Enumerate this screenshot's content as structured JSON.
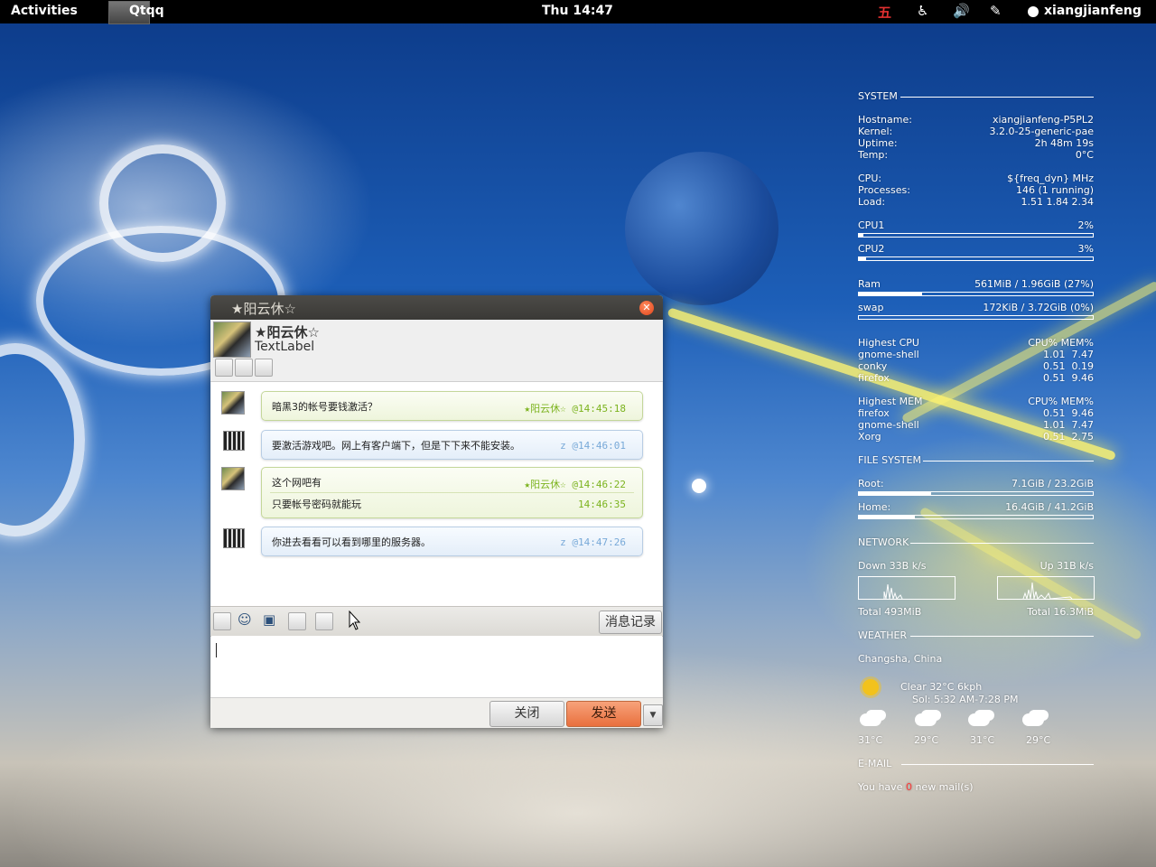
{
  "topbar": {
    "activities": "Activities",
    "app_name": "Qtqq",
    "clock": "Thu 14:47",
    "ime_indicator": "五",
    "icons": [
      "accessibility-icon",
      "volume-icon",
      "network-icon"
    ],
    "user": "xiangjianfeng"
  },
  "conky": {
    "system": {
      "title": "SYSTEM",
      "rows": [
        {
          "label": "Hostname:",
          "value": "xiangjianfeng-P5PL2"
        },
        {
          "label": "Kernel:",
          "value": "3.2.0-25-generic-pae"
        },
        {
          "label": "Uptime:",
          "value": "2h 48m 19s"
        },
        {
          "label": "Temp:",
          "value": "0°C"
        }
      ],
      "rows2": [
        {
          "label": "CPU:",
          "value": "${freq_dyn} MHz"
        },
        {
          "label": "Processes:",
          "value": "146 (1 running)"
        },
        {
          "label": "Load:",
          "value": "1.51 1.84 2.34"
        }
      ],
      "cpu1": {
        "label": "CPU1",
        "value": "2%",
        "fraction": 0.02
      },
      "cpu2": {
        "label": "CPU2",
        "value": "3%",
        "fraction": 0.03
      },
      "ram": {
        "label": "Ram",
        "value": "561MiB / 1.96GiB (27%)",
        "fraction": 0.27
      },
      "swap": {
        "label": "swap",
        "value": "172KiB / 3.72GiB (0%)",
        "fraction": 0.0
      }
    },
    "top_cpu": {
      "header_l": "Highest CPU",
      "header_r": "CPU% MEM%",
      "rows": [
        {
          "name": "gnome-shell",
          "vals": "1.01  7.47"
        },
        {
          "name": "conky",
          "vals": "0.51  0.19"
        },
        {
          "name": "firefox",
          "vals": "0.51  9.46"
        }
      ]
    },
    "top_mem": {
      "header_l": "Highest MEM",
      "header_r": "CPU% MEM%",
      "rows": [
        {
          "name": "firefox",
          "vals": "0.51  9.46"
        },
        {
          "name": "gnome-shell",
          "vals": "1.01  7.47"
        },
        {
          "name": "Xorg",
          "vals": "0.51  2.75"
        }
      ]
    },
    "fs": {
      "title": "FILE SYSTEM",
      "root": {
        "label": "Root:",
        "value": "7.1GiB / 23.2GiB",
        "fraction": 0.31
      },
      "home": {
        "label": "Home:",
        "value": "16.4GiB / 41.2GiB",
        "fraction": 0.24
      }
    },
    "network": {
      "title": "NETWORK",
      "down": "Down 33B k/s",
      "up": "Up 31B k/s",
      "total_down": "Total 493MiB",
      "total_up": "Total 16.3MiB"
    },
    "weather": {
      "title": "WEATHER",
      "location": "Changsha, China",
      "current": "Clear   32°C   6kph",
      "sun": "Sol: 5:32 AM-7:28 PM",
      "forecast": [
        "31°C",
        "29°C",
        "31°C",
        "29°C"
      ]
    },
    "email": {
      "title": "E-MAIL",
      "prefix": "You have ",
      "count": "0",
      "suffix": " new mail(s)"
    }
  },
  "chat": {
    "title": "★阳云休☆",
    "contact_name": "★阳云休☆",
    "contact_sub": "TextLabel",
    "messages": [
      {
        "text": "暗黑3的帐号要钱激活？",
        "time": "★阳云休☆ @14:45:18",
        "side": "green"
      },
      {
        "text": "要激活游戏吧。网上有客户端下，但是下下来不能安装。",
        "time": "z @14:46:01",
        "side": "blue"
      },
      {
        "text": "这个网吧有",
        "time": "★阳云休☆ @14:46:22",
        "side": "green",
        "text2": "只要帐号密码就能玩",
        "time2": "14:46:35"
      },
      {
        "text": "你进去看看可以看到哪里的服务器。",
        "time": "z @14:47:26",
        "side": "blue"
      }
    ],
    "history_button": "消息记录",
    "close_button": "关闭",
    "send_button": "发送",
    "dropdown_glyph": "▼"
  }
}
